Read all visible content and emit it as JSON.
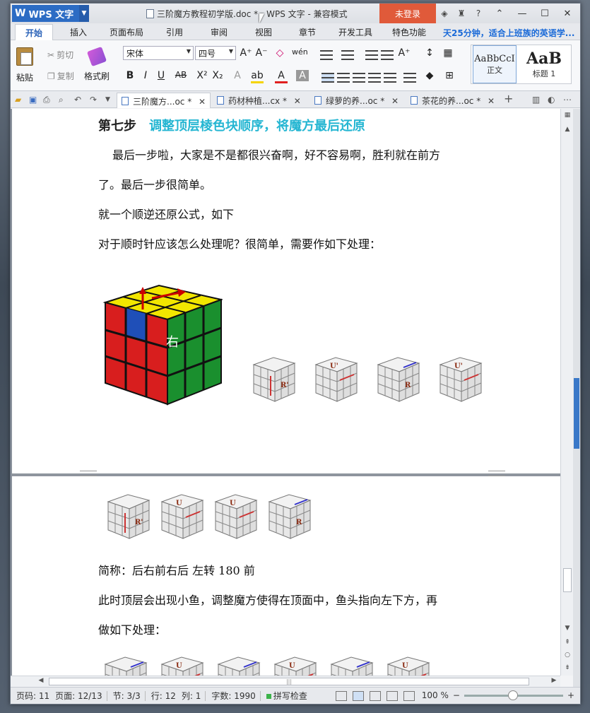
{
  "app": {
    "name": "WPS 文字",
    "window_title": "三阶魔方教程初学版.doc * - WPS 文字 - 兼容模式",
    "login_label": "未登录"
  },
  "ribbon_tabs": [
    {
      "label": "开始",
      "active": true
    },
    {
      "label": "插入"
    },
    {
      "label": "页面布局"
    },
    {
      "label": "引用"
    },
    {
      "label": "审阅"
    },
    {
      "label": "视图"
    },
    {
      "label": "章节"
    },
    {
      "label": "开发工具"
    },
    {
      "label": "特色功能"
    }
  ],
  "promo_text": "天25分钟，适合上班族的英语学...",
  "ribbon": {
    "paste": "粘贴",
    "cut": "剪切",
    "copy": "复制",
    "format_painter": "格式刷",
    "font_name": "宋体",
    "font_size": "四号",
    "style_normal_sample": "AaBbCcI",
    "style_normal": "正文",
    "style_h1_sample": "AaB",
    "style_h1": "标题 1"
  },
  "doc_tabs": [
    {
      "label": "三阶魔方...oc *",
      "active": true
    },
    {
      "label": "药材种植...cx *"
    },
    {
      "label": "绿萝的养...oc *"
    },
    {
      "label": "茶花的养...oc *"
    }
  ],
  "document": {
    "heading_step": "第七步",
    "heading_title": "调整顶层棱色块顺序，将魔方最后还原",
    "para1_line1": "最后一步啦，大家是不是都很兴奋啊，好不容易啊，胜利就在前方",
    "para1_line2": "了。最后一步很简单。",
    "para2": "就一个顺逆还原公式，如下",
    "para3": "对于顺时针应该怎么处理呢？很简单，需要作如下处理：",
    "cube_label": "右",
    "moves_row1": [
      "R'",
      "U'",
      "R",
      "U'"
    ],
    "moves_row2": [
      "R'",
      "U",
      "U",
      "R"
    ],
    "moves_row3": [
      "R",
      "U",
      "R",
      "U",
      "R",
      "U"
    ],
    "para4": "简称：后右前右后   左转 180  前",
    "para5_line1": "此时顶层会出现小鱼，调整魔方使得在顶面中，鱼头指向左下方，再",
    "para5_line2": "做如下处理："
  },
  "status": {
    "page_code": "页码: 11",
    "page": "页面: 12/13",
    "section": "节: 3/3",
    "row": "行: 12",
    "col": "列: 1",
    "word_count": "字数: 1990",
    "spell_check": "拼写检查",
    "zoom": "100 %"
  },
  "colors": {
    "accent": "#2c6cc4",
    "login": "#e05a3a",
    "heading_sub": "#25b6d2"
  }
}
